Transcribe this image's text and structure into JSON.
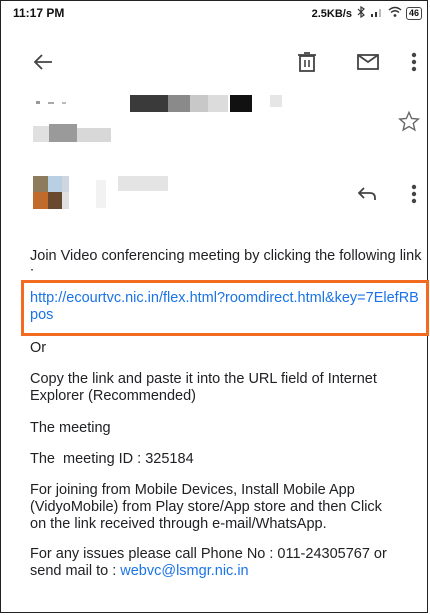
{
  "status_bar": {
    "time": "11:17 PM",
    "network_speed": "2.5KB/s",
    "battery": "46"
  },
  "toolbar": {
    "back_icon": "arrow-left-icon",
    "delete_icon": "trash-icon",
    "mail_icon": "envelope-icon",
    "more_icon": "more-vertical-icon"
  },
  "sender_header": {
    "star_icon": "star-outline-icon",
    "reply_icon": "reply-icon",
    "more_icon": "more-vertical-icon"
  },
  "message": {
    "intro": "Join Video conferencing meeting by clicking the following link :",
    "link": "http://ecourtvc.nic.in/flex.html?roomdirect.html&key=7ElefRBpos",
    "or": "Or",
    "copy_instructions": "Copy the link and paste it into the URL field of Internet Explorer (Recommended)",
    "meeting_heading": "The meeting",
    "meeting_id": "The  meeting ID : 325184",
    "mobile_instructions": "For joining from Mobile Devices, Install Mobile App (VidyoMobile) from Play store/App store and then Click on the link received through e-mail/WhatsApp.",
    "support_prefix": "For any issues please call Phone No : 011-24305767 or send mail to : ",
    "support_email": "webvc@lsmgr.nic.in"
  },
  "colors": {
    "link": "#1a73e8",
    "highlight": "#f36b21",
    "text": "#202124"
  }
}
